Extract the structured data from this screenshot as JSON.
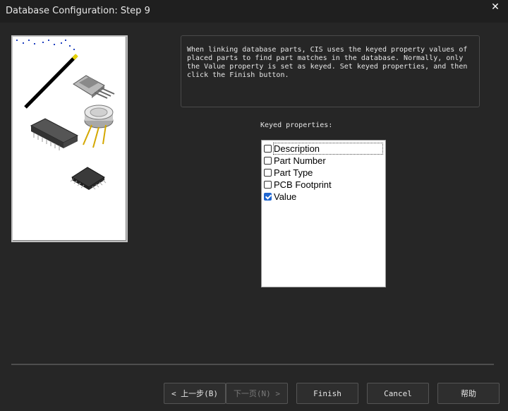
{
  "window": {
    "title": "Database Configuration: Step 9",
    "close_glyph": "✕"
  },
  "info": {
    "text": "When linking database parts, CIS uses the keyed property values of placed parts to find part matches in the database. Normally, only the Value property is set as keyed. Set keyed properties, and then click the Finish button."
  },
  "keyed": {
    "label": "Keyed properties:",
    "items": [
      {
        "label": "Description",
        "checked": false
      },
      {
        "label": "Part Number",
        "checked": false
      },
      {
        "label": "Part Type",
        "checked": false
      },
      {
        "label": "PCB Footprint",
        "checked": false
      },
      {
        "label": "Value",
        "checked": true
      }
    ]
  },
  "buttons": {
    "back": "< 上一步(B)",
    "next": "下一页(N) >",
    "finish": "Finish",
    "cancel": "Cancel",
    "help": "帮助"
  }
}
